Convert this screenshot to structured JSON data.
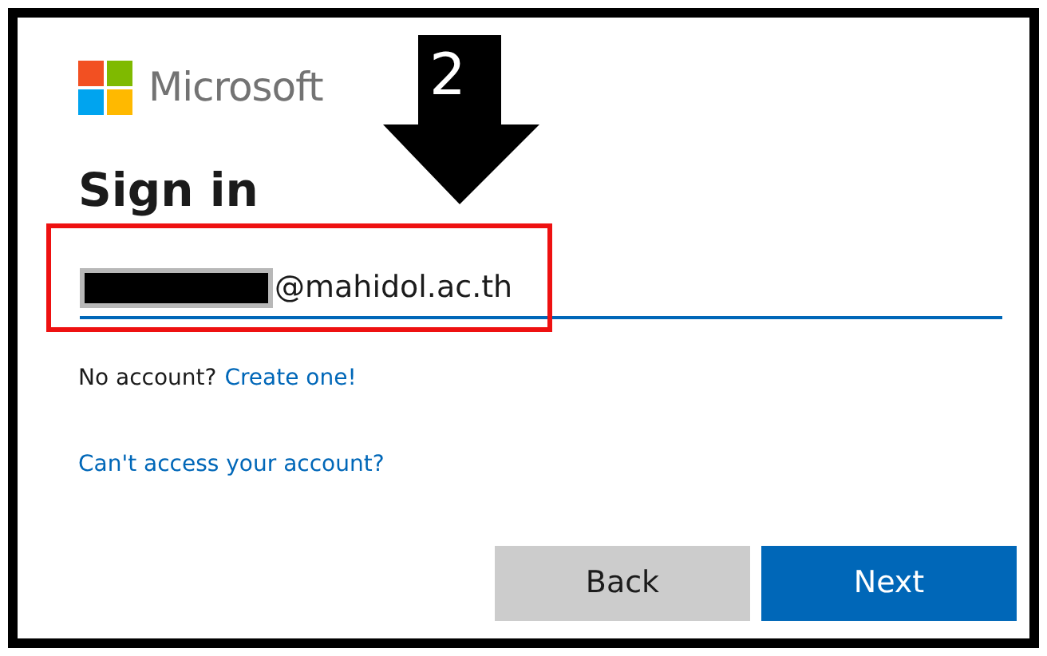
{
  "annotation": {
    "step": "2",
    "highlight_field": true
  },
  "brand": {
    "name": "Microsoft"
  },
  "title": "Sign in",
  "email_field": {
    "value": "@mahidol.ac.th",
    "redacted": true
  },
  "no_account": {
    "text": "No account?",
    "link": "Create one!"
  },
  "access_link": "Can't access your account?",
  "buttons": [
    {
      "label": "Back",
      "kind": "secondary"
    },
    {
      "label": "Next",
      "kind": "primary"
    }
  ]
}
